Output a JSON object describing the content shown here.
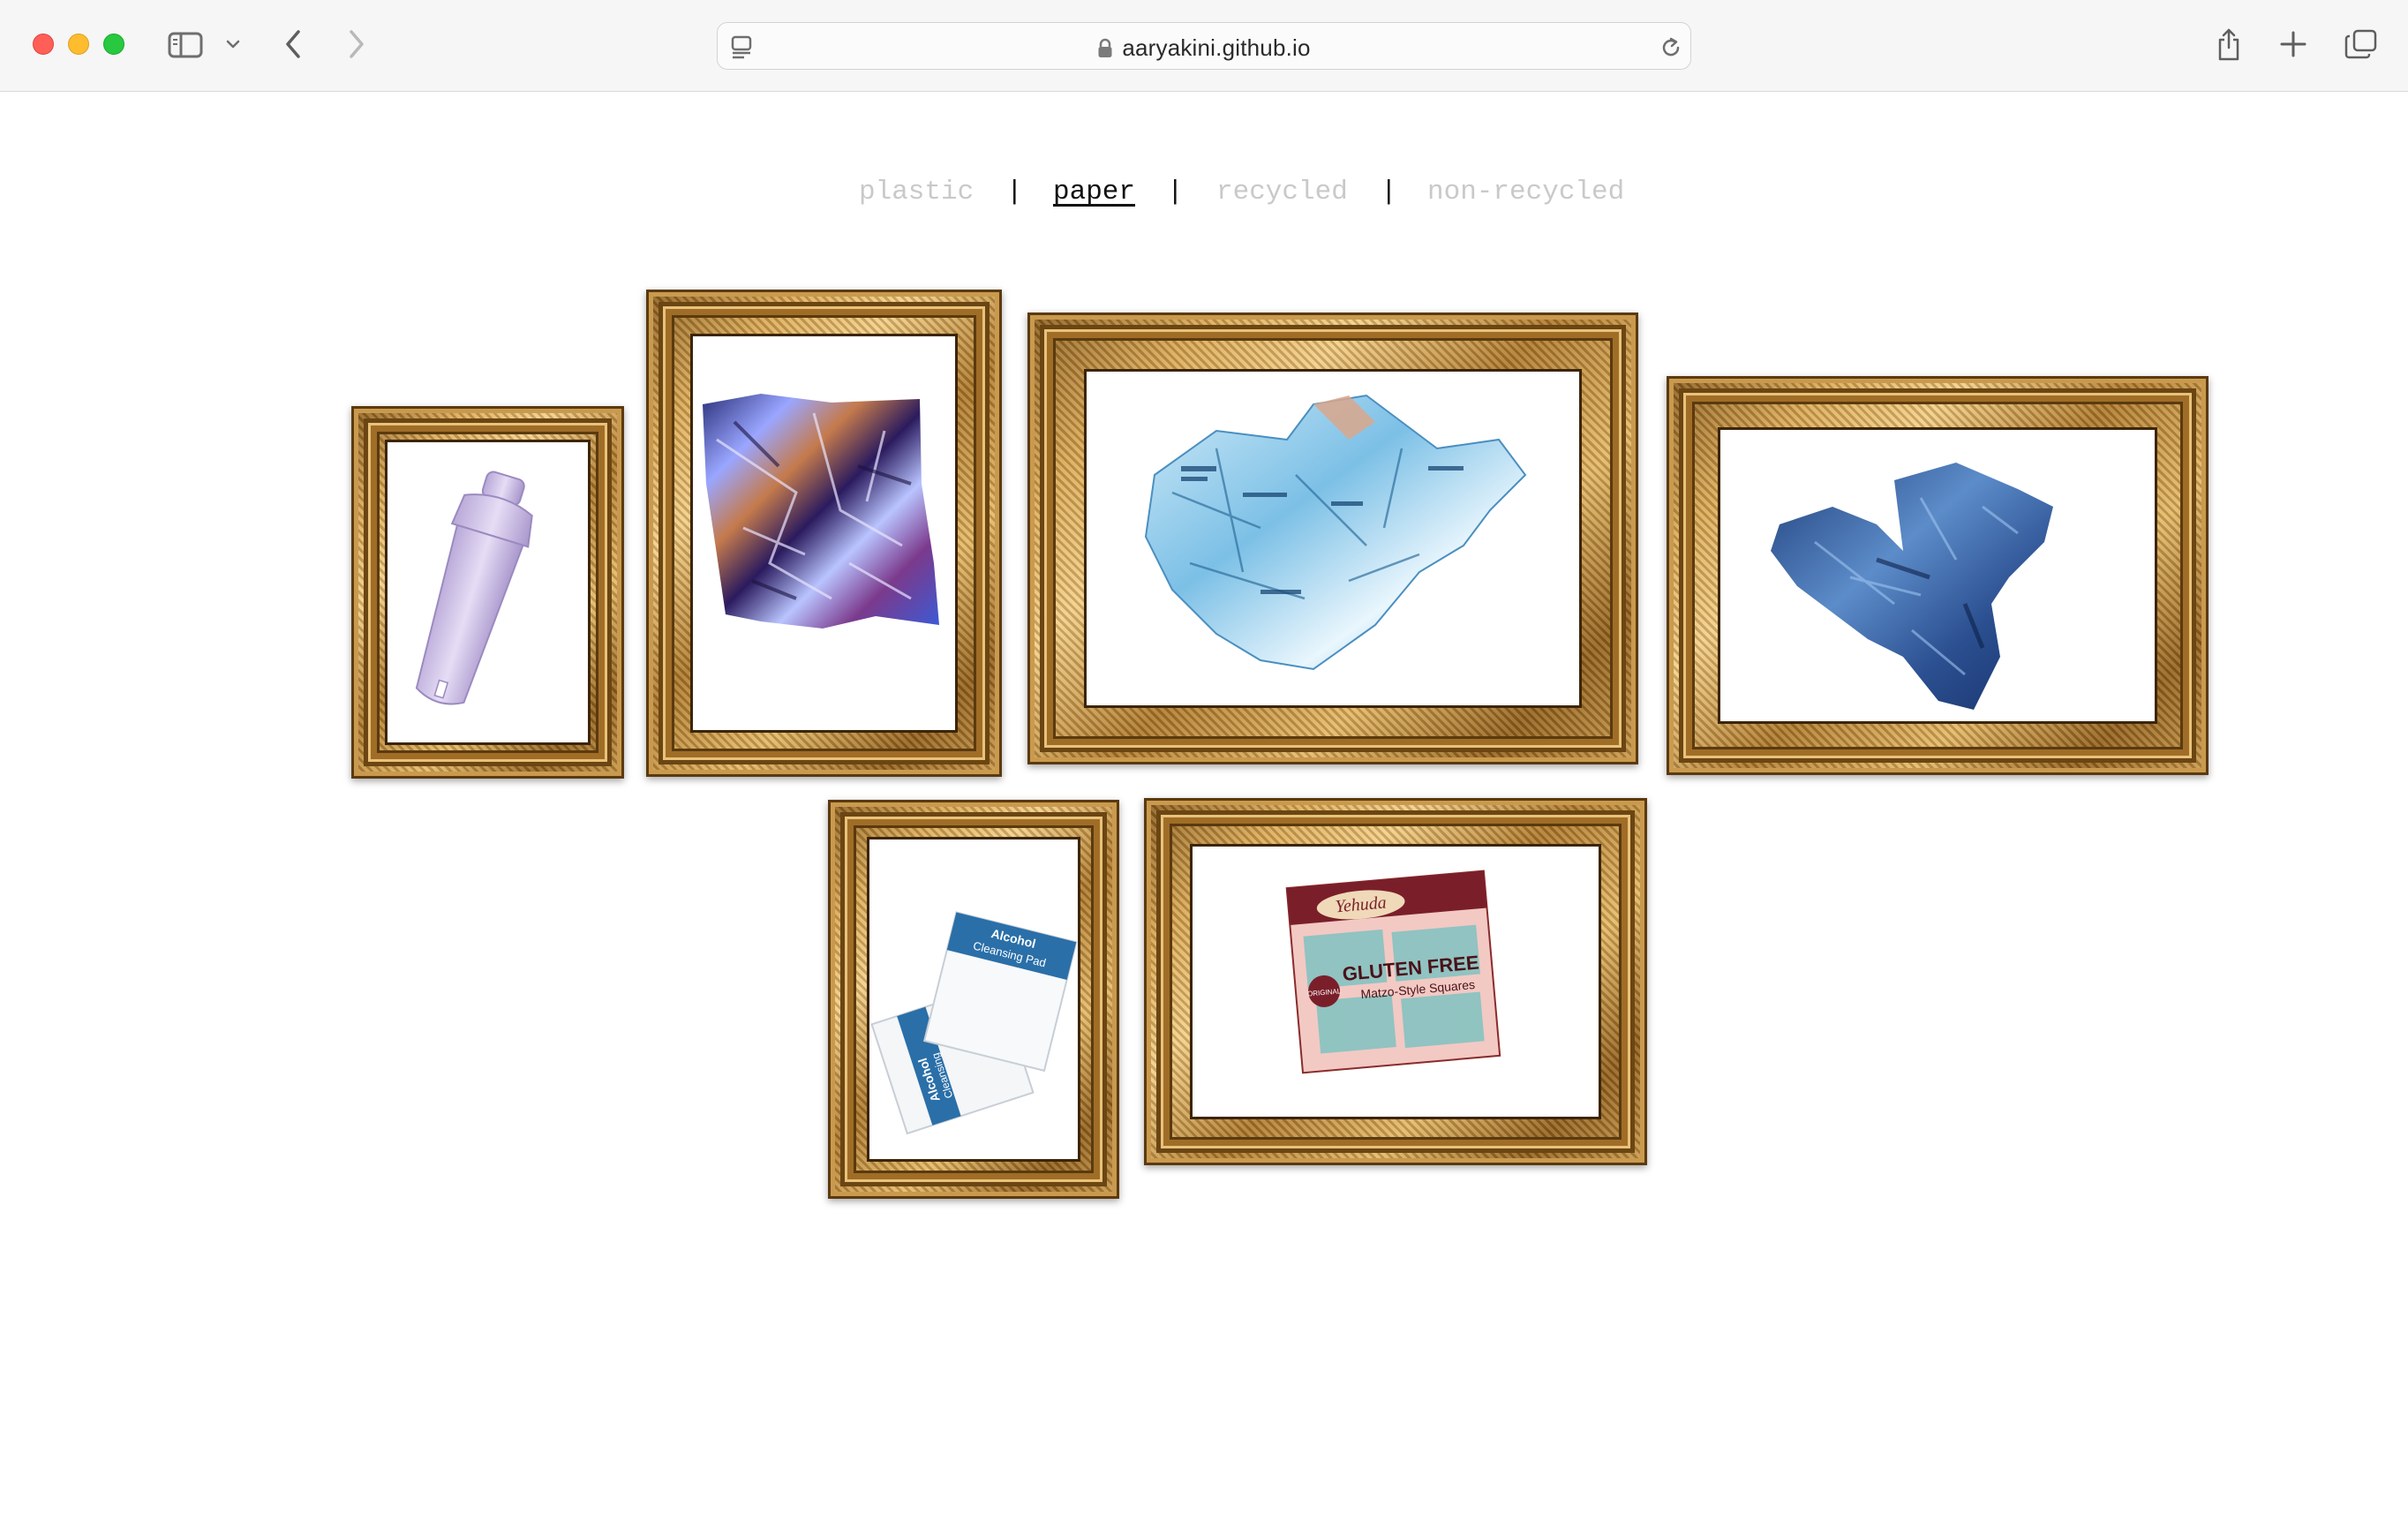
{
  "browser": {
    "url": "aaryakini.github.io",
    "icons": {
      "close": "close-window-dot",
      "minimize": "minimize-window-dot",
      "maximize": "maximize-window-dot",
      "sidebar": "sidebar-icon",
      "tab_group_menu": "chevron-down-icon",
      "back": "back-icon",
      "forward": "forward-icon",
      "page_menu": "page-menu-icon",
      "lock": "lock-icon",
      "reload": "reload-icon",
      "share": "share-icon",
      "new_tab": "plus-icon",
      "tabs_overview": "tabs-overview-icon"
    }
  },
  "nav": {
    "items": [
      {
        "label": "plastic",
        "active": false
      },
      {
        "label": "paper",
        "active": true
      },
      {
        "label": "recycled",
        "active": false
      },
      {
        "label": "non-recycled",
        "active": false
      }
    ],
    "separator": "|"
  },
  "gallery": {
    "frames": [
      {
        "content": "water-filter-cartridge-image"
      },
      {
        "content": "crumpled-foil-wrapper-image"
      },
      {
        "content": "crumpled-receipt-paper-image"
      },
      {
        "content": "crumpled-blue-cloth-image"
      },
      {
        "content": "alcohol-pads-image",
        "texts": [
          "Alcohol",
          "Cleansing Pad",
          "Alcohol",
          "Cleansing"
        ]
      },
      {
        "content": "matzo-box-image",
        "texts": [
          "Yehuda",
          "GLUTEN FREE",
          "Matzo-Style Squares",
          "ORIGINAL"
        ]
      }
    ]
  }
}
